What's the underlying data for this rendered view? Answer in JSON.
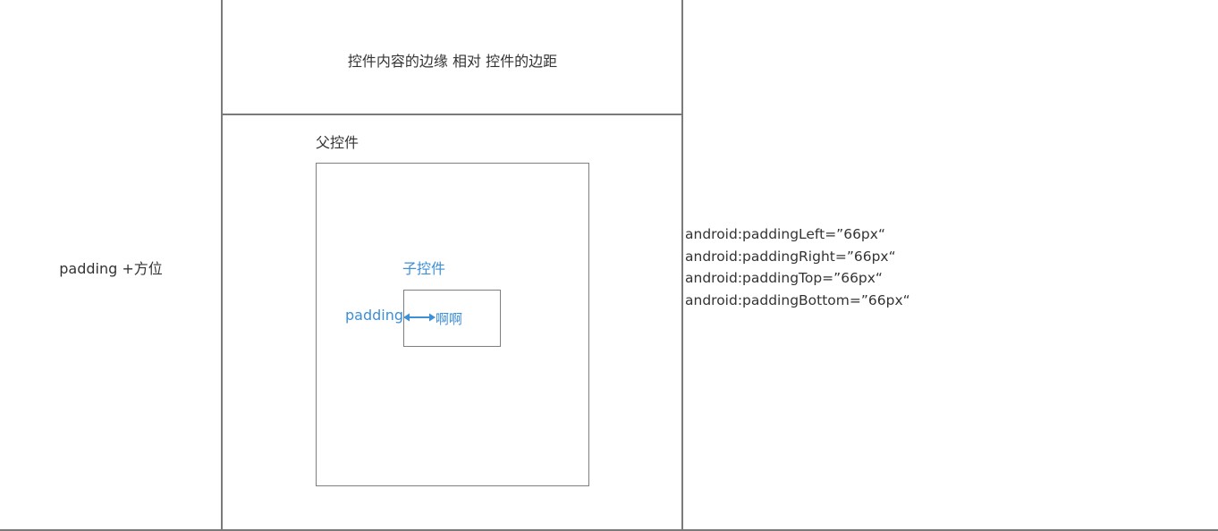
{
  "row": {
    "label": "padding +方位"
  },
  "diagram": {
    "caption": "控件内容的边缘 相对 控件的边距",
    "parent_label": "父控件",
    "child_label": "子控件",
    "padding_label": "padding",
    "content_label": "啊啊",
    "accent_color": "#3d8fd6"
  },
  "code": {
    "lines": [
      "android:paddingLeft=”66px“",
      "android:paddingRight=”66px“",
      "android:paddingTop=”66px“",
      "android:paddingBottom=”66px“"
    ]
  }
}
